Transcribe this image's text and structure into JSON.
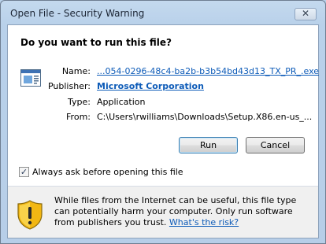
{
  "window": {
    "title": "Open File - Security Warning",
    "close_glyph": "✕"
  },
  "heading": "Do you want to run this file?",
  "file_info": {
    "name_label": "Name:",
    "name_value": "...054-0296-48c4-ba2b-b3b54bd43d13_TX_PR_.exe",
    "publisher_label": "Publisher:",
    "publisher_value": "Microsoft Corporation",
    "type_label": "Type:",
    "type_value": "Application",
    "from_label": "From:",
    "from_value": "C:\\Users\\rwilliams\\Downloads\\Setup.X86.en-us_..."
  },
  "buttons": {
    "run": "Run",
    "cancel": "Cancel"
  },
  "always_ask": {
    "checked": true,
    "label": "Always ask before opening this file"
  },
  "warning": {
    "text": "While files from the Internet can be useful, this file type can potentially harm your computer. Only run software from publishers you trust.",
    "link": "What's the risk?"
  },
  "icons": {
    "file": "application-window-icon",
    "warning": "warning-shield-icon",
    "check": "✓"
  }
}
